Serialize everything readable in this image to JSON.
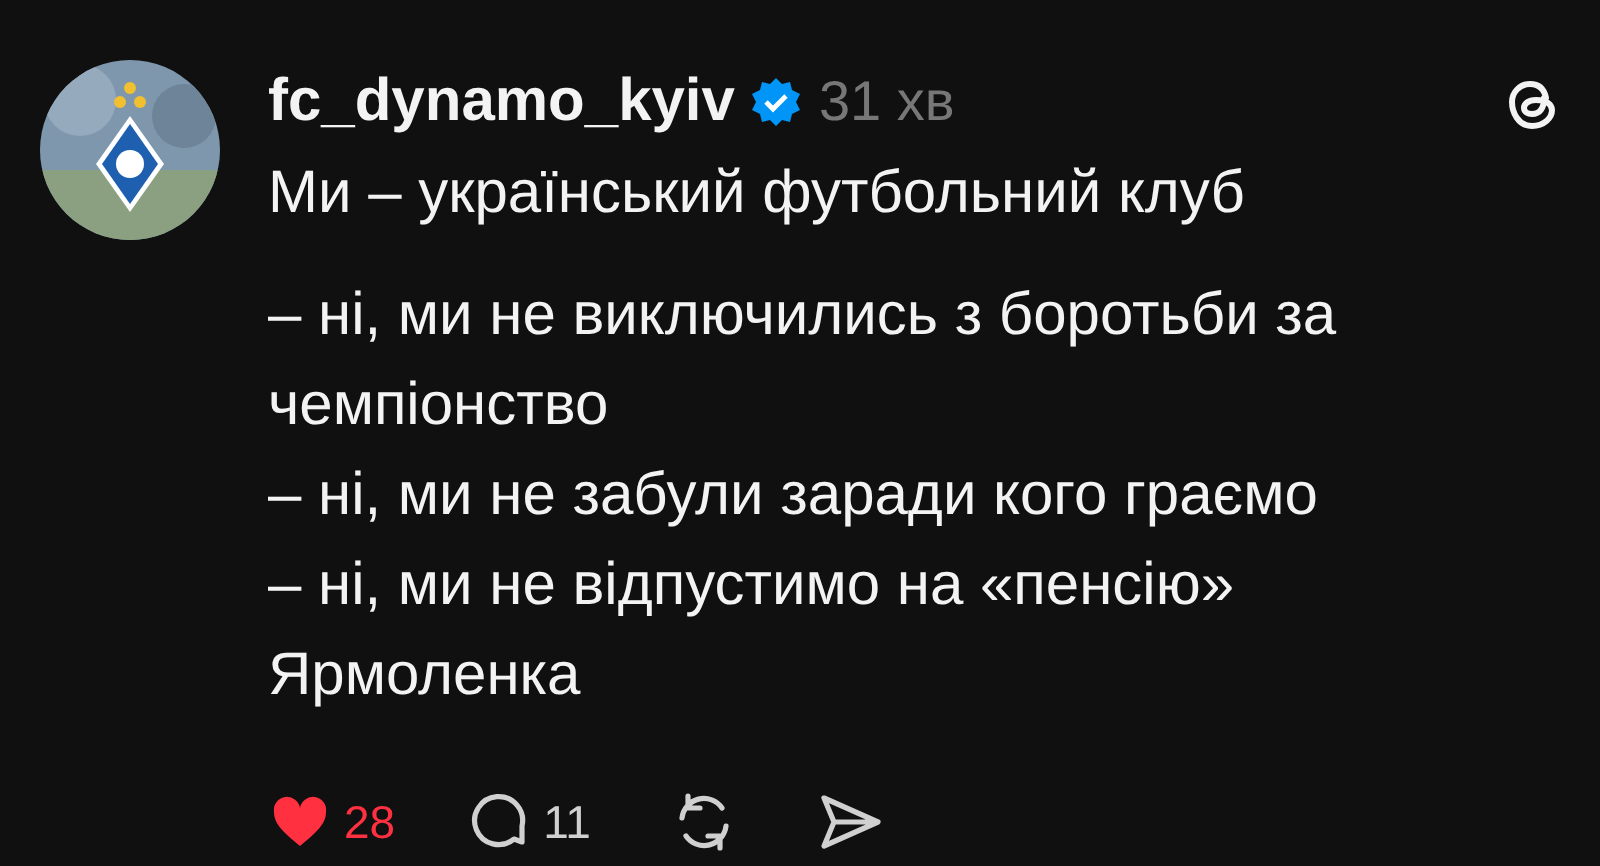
{
  "post": {
    "username": "fc_dynamo_kyiv",
    "verified": true,
    "time": "31 хв",
    "intro": "Ми – український футбольний клуб",
    "lines": [
      "– ні, ми не виключились з боротьби за чемпіонство",
      "– ні, ми не забули заради кого граємо",
      "– ні, ми не відпустимо на «пенсію» Ярмоленка"
    ]
  },
  "actions": {
    "liked": true,
    "likes": "28",
    "replies": "11"
  }
}
